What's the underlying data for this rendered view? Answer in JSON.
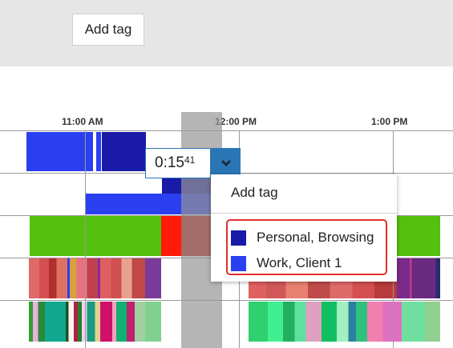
{
  "toolbar": {
    "add_tag_label": "Add tag"
  },
  "timeline": {
    "time_labels": [
      "11:00 AM",
      "12:00 PM",
      "1:00 PM"
    ],
    "selection": {
      "duration_main": "0:15",
      "duration_seconds": "41"
    }
  },
  "dropdown": {
    "add_tag_label": "Add tag",
    "tags": [
      {
        "label": "Personal, Browsing",
        "color": "#1a1aa8"
      },
      {
        "label": "Work, Client 1",
        "color": "#2a3ff0"
      }
    ]
  }
}
